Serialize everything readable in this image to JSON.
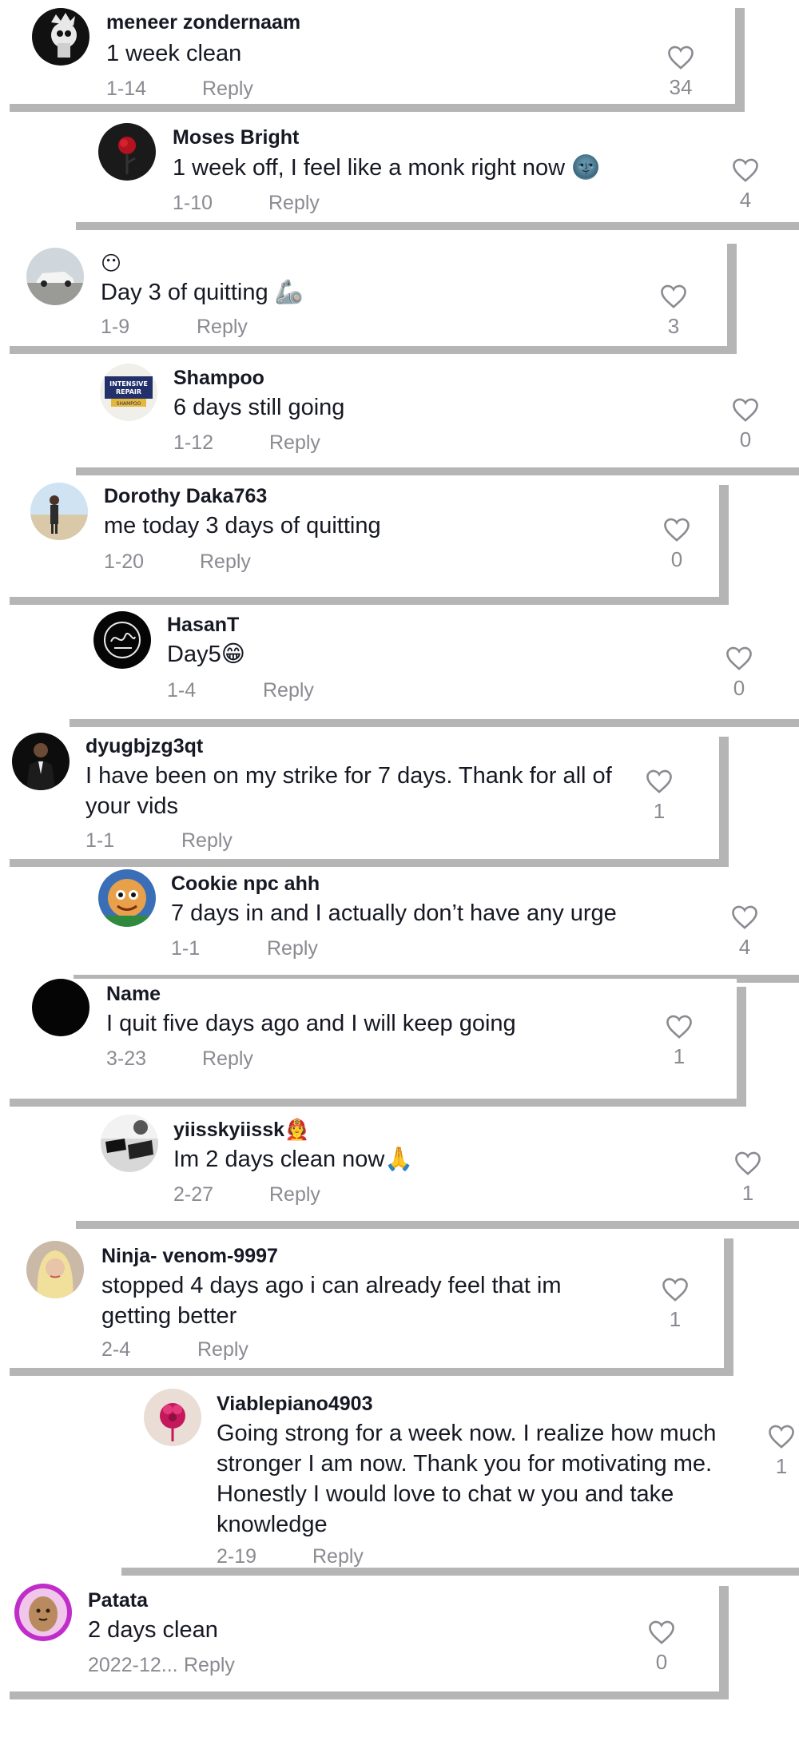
{
  "comments": [
    {
      "username": "meneer zondernaam",
      "text": "1 week clean",
      "date": "1-14",
      "reply": "Reply",
      "likes": "34",
      "avatar": "skull-avatar"
    },
    {
      "username": "Moses Bright",
      "text": "1 week off, I feel like a monk right now 🌚",
      "date": "1-10",
      "reply": "Reply",
      "likes": "4",
      "avatar": "rose-avatar"
    },
    {
      "username": "😶",
      "text": "Day 3 of quitting 🦾",
      "date": "1-9",
      "reply": "Reply",
      "likes": "3",
      "avatar": "car-avatar"
    },
    {
      "username": "Shampoo",
      "text": "6 days still going",
      "date": "1-12",
      "reply": "Reply",
      "likes": "0",
      "avatar": "shampoo-avatar",
      "avatar_text": [
        "INTENSIVE",
        "REPAIR",
        "SHAMPOO"
      ]
    },
    {
      "username": "Dorothy Daka763",
      "text": "me today 3 days of quitting",
      "date": "1-20",
      "reply": "Reply",
      "likes": "0",
      "avatar": "person-outdoor-avatar"
    },
    {
      "username": "HasanT",
      "text": "Day5😁",
      "date": "1-4",
      "reply": "Reply",
      "likes": "0",
      "avatar": "calligraphy-avatar"
    },
    {
      "username": "dyugbjzg3qt",
      "text": "I have been on my strike for 7 days. Thank for all of your vids",
      "date": "1-1",
      "reply": "Reply",
      "likes": "1",
      "avatar": "suit-avatar"
    },
    {
      "username": "Cookie npc ahh",
      "text": "7 days in and I actually don’t have any urge",
      "date": "1-1",
      "reply": "Reply",
      "likes": "4",
      "avatar": "cartoon-avatar"
    },
    {
      "username": "Name",
      "text": "I quit five days ago and I will keep going",
      "date": "3-23",
      "reply": "Reply",
      "likes": "1",
      "avatar": "black-avatar"
    },
    {
      "username": "yiisskyiissk🧑‍🚒",
      "text": "Im 2 days clean now🙏",
      "date": "2-27",
      "reply": "Reply",
      "likes": "1",
      "avatar": "bw-photo-avatar"
    },
    {
      "username": "Ninja- venom-9997",
      "text": "stopped 4 days ago i can already feel that im getting better",
      "date": "2-4",
      "reply": "Reply",
      "likes": "1",
      "avatar": "blonde-avatar"
    },
    {
      "username": "Viablepiano4903",
      "text": "Going strong for a week now. I realize how much stronger I am now. Thank you for motivating me. Honestly I would love to chat w you and take knowledge",
      "date": "2-19",
      "reply": "Reply",
      "likes": "1",
      "avatar": "pink-flower-avatar"
    },
    {
      "username": "Patata",
      "text": "2 days clean",
      "date": "2022-12...",
      "reply": "Reply",
      "likes": "0",
      "avatar": "potato-avatar"
    }
  ],
  "colors": {
    "text": "#161823",
    "meta": "#8a8b91",
    "shadow": "#b5b5b5",
    "background": "#ffffff"
  }
}
